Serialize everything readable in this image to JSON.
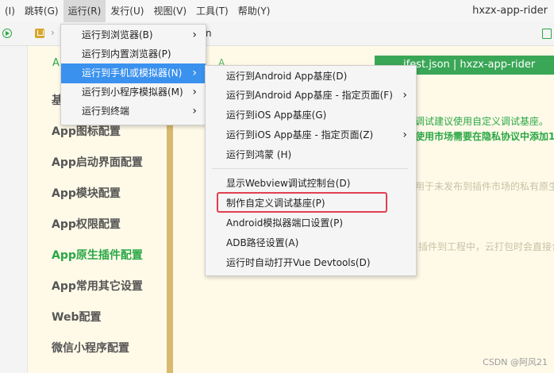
{
  "menubar": {
    "items": [
      {
        "label": "(I)"
      },
      {
        "label": "跳转(G)"
      },
      {
        "label": "运行(R)"
      },
      {
        "label": "发行(U)"
      },
      {
        "label": "视图(V)"
      },
      {
        "label": "工具(T)"
      },
      {
        "label": "帮助(Y)"
      }
    ],
    "window_title": "hxzx-app-rider"
  },
  "toolbar": {
    "breadcrumb_tail": "n"
  },
  "nav": {
    "top_partial": "A",
    "items": [
      {
        "label": "基"
      },
      {
        "label": "App图标配置"
      },
      {
        "label": "App启动界面配置"
      },
      {
        "label": "App模块配置"
      },
      {
        "label": "App权限配置"
      },
      {
        "label": "App原生插件配置"
      },
      {
        "label": "App常用其它设置"
      },
      {
        "label": "Web配置"
      },
      {
        "label": "微信小程序配置"
      }
    ]
  },
  "content": {
    "tab_partial": "A",
    "active_tab": "ifest.json | hxzx-app-rider",
    "line1": "调试建议使用自定义调试基座。",
    "line2": "使用市场需要在隐私协议中添加1",
    "line3": "用于未发布到插件市场的私有原生插",
    "line4": "插件到工程中，云打包时会直接合"
  },
  "run_menu": {
    "items": [
      {
        "label": "运行到浏览器(B)",
        "has_submenu": true
      },
      {
        "label": "运行到内置浏览器(P)",
        "has_submenu": false
      },
      {
        "label": "运行到手机或模拟器(N)",
        "has_submenu": true
      },
      {
        "label": "运行到小程序模拟器(M)",
        "has_submenu": true
      },
      {
        "label": "运行到终端",
        "has_submenu": true
      }
    ]
  },
  "emulator_submenu": {
    "items": [
      {
        "label": "运行到Android App基座(D)"
      },
      {
        "label": "运行到Android App基座 - 指定页面(F)"
      },
      {
        "label": "运行到iOS App基座(G)"
      },
      {
        "label": "运行到iOS App基座 - 指定页面(Z)"
      },
      {
        "label": "运行到鸿蒙 (H)"
      },
      {
        "label": "显示Webview调试控制台(D)"
      },
      {
        "label": "制作自定义调试基座(P)"
      },
      {
        "label": "Android模拟器端口设置(P)"
      },
      {
        "label": "ADB路径设置(A)"
      },
      {
        "label": "运行时自动打开Vue Devtools(D)"
      }
    ]
  },
  "watermark": "CSDN @阿风21",
  "colors": {
    "accent_green": "#2aa745",
    "menu_highlight": "#3a91ee",
    "annotation_red": "#e0404f",
    "background": "#fffae8"
  },
  "icons": {
    "run": "run-icon",
    "project": "project-icon",
    "submenu": "chevron-right-icon"
  }
}
